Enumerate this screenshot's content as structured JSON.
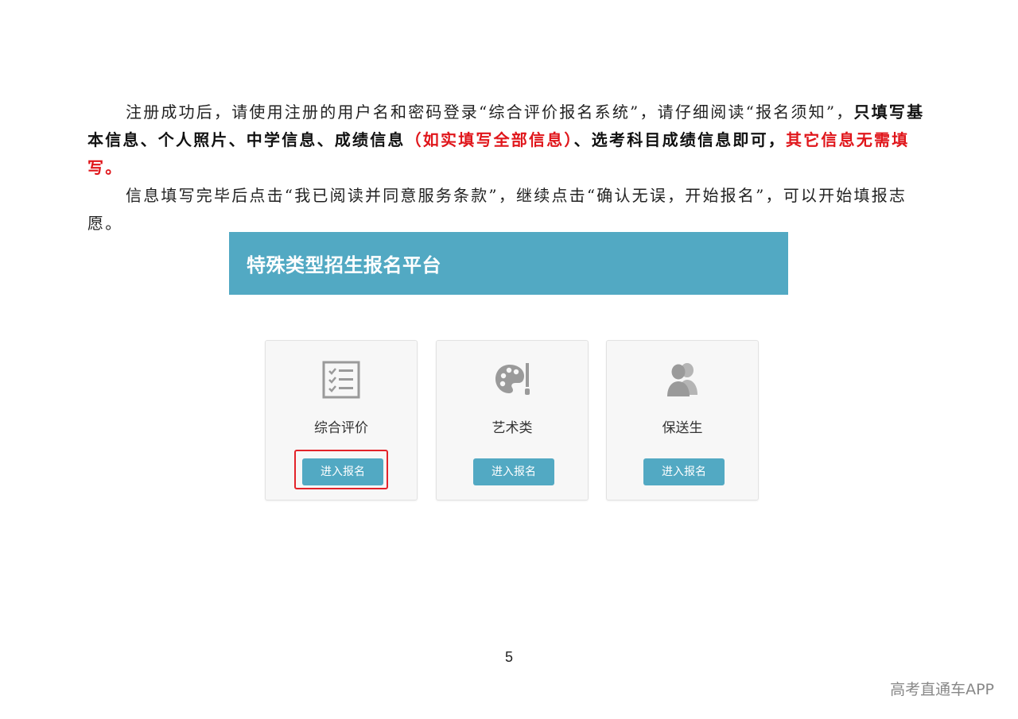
{
  "paragraph1": {
    "line1": "注册成功后，请使用注册的用户名和密码登录“综合评价报名系统”，请仔细阅读“报名须知”，",
    "bold1": "只填写基本信息、个人照片、中学信息、成绩信息",
    "red1": "（如实填写全部信息）",
    "bold2": "、选考科目成绩信息即可，",
    "red2": "其它信息无需填写。"
  },
  "paragraph2": {
    "text": "信息填写完毕后点击“我已阅读并同意服务条款”，继续点击“确认无误，开始报名”，可以开始填报志愿。"
  },
  "screenshot": {
    "banner_title": "特殊类型招生报名平台",
    "cards": [
      {
        "label": "综合评价",
        "button": "进入报名",
        "icon": "checklist-icon"
      },
      {
        "label": "艺术类",
        "button": "进入报名",
        "icon": "palette-icon"
      },
      {
        "label": "保送生",
        "button": "进入报名",
        "icon": "users-icon"
      }
    ]
  },
  "page_number": "5",
  "watermark": "高考直通车APP",
  "colors": {
    "accent": "#52a9c3",
    "highlight_red": "#e3232a",
    "text_red": "#e0161b"
  }
}
